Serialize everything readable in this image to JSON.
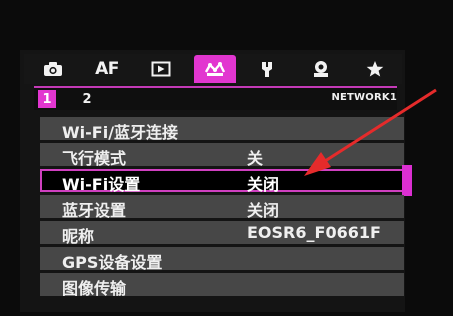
{
  "tabs": [
    {
      "name": "camera-icon",
      "text": ""
    },
    {
      "name": "af",
      "text": "AF"
    },
    {
      "name": "playback-icon",
      "text": ""
    },
    {
      "name": "network-icon",
      "text": ""
    },
    {
      "name": "wrench-icon",
      "text": ""
    },
    {
      "name": "custom-icon",
      "text": ""
    },
    {
      "name": "star-icon",
      "text": ""
    }
  ],
  "subtabs": {
    "page1": "1",
    "page2": "2",
    "title": "NETWORK1"
  },
  "menu": [
    {
      "label": "Wi-Fi/蓝牙连接",
      "value": ""
    },
    {
      "label": "飞行模式",
      "value": "关"
    },
    {
      "label": "Wi-Fi设置",
      "value": "关闭"
    },
    {
      "label": "蓝牙设置",
      "value": "关闭"
    },
    {
      "label": "昵称",
      "value": "EOSR6_F0661F"
    },
    {
      "label": "GPS设备设置",
      "value": ""
    },
    {
      "label": "图像传输",
      "value": ""
    }
  ],
  "colors": {
    "accent": "#e236d0",
    "arrow": "#e52b2b"
  }
}
